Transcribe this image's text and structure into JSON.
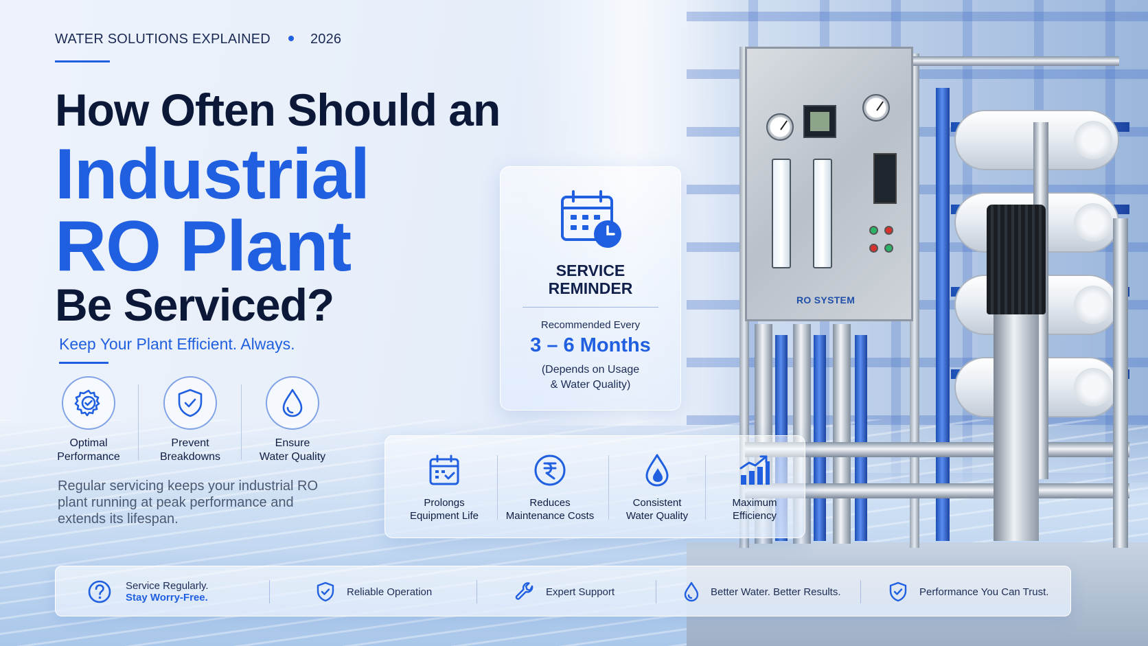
{
  "header": {
    "kicker": "WATER SOLUTIONS EXPLAINED",
    "year": "2026"
  },
  "headline": {
    "line1": "How Often Should an",
    "line2": "Industrial",
    "line3": "RO Plant",
    "line4": "Be Serviced?"
  },
  "tagline": "Keep Your Plant Efficient. Always.",
  "features": [
    {
      "icon": "gear-check-icon",
      "line1": "Optimal",
      "line2": "Performance"
    },
    {
      "icon": "shield-check-icon",
      "line1": "Prevent",
      "line2": "Breakdowns"
    },
    {
      "icon": "water-drop-icon",
      "line1": "Ensure",
      "line2": "Water Quality"
    }
  ],
  "paragraph": "Regular servicing keeps your industrial RO plant running at peak performance and extends its lifespan.",
  "service_card": {
    "icon": "calendar-clock-icon",
    "title_line1": "SERVICE",
    "title_line2": "REMINDER",
    "recommended": "Recommended Every",
    "interval": "3 – 6 Months",
    "note_line1": "(Depends on Usage",
    "note_line2": "& Water Quality)"
  },
  "benefits": [
    {
      "icon": "calendar-check-icon",
      "line1": "Prolongs",
      "line2": "Equipment Life"
    },
    {
      "icon": "rupee-coin-icon",
      "line1": "Reduces",
      "line2": "Maintenance Costs"
    },
    {
      "icon": "water-drop-icon",
      "line1": "Consistent",
      "line2": "Water Quality"
    },
    {
      "icon": "bar-chart-up-icon",
      "line1": "Maximum",
      "line2": "Efficiency"
    }
  ],
  "machine": {
    "label": "RO SYSTEM"
  },
  "bottom_bar": {
    "service_line1": "Service Regularly.",
    "service_line2": "Stay Worry-Free.",
    "items": [
      {
        "icon": "shield-check-icon",
        "label": "Reliable Operation"
      },
      {
        "icon": "wrench-icon",
        "label": "Expert Support"
      },
      {
        "icon": "water-drop-icon",
        "label": "Better Water. Better Results."
      },
      {
        "icon": "shield-check-icon",
        "label": "Performance You Can Trust."
      }
    ]
  },
  "colors": {
    "accent": "#1f5fe0",
    "dark_text": "#0b1838",
    "light_bg": "#eef3fb"
  }
}
